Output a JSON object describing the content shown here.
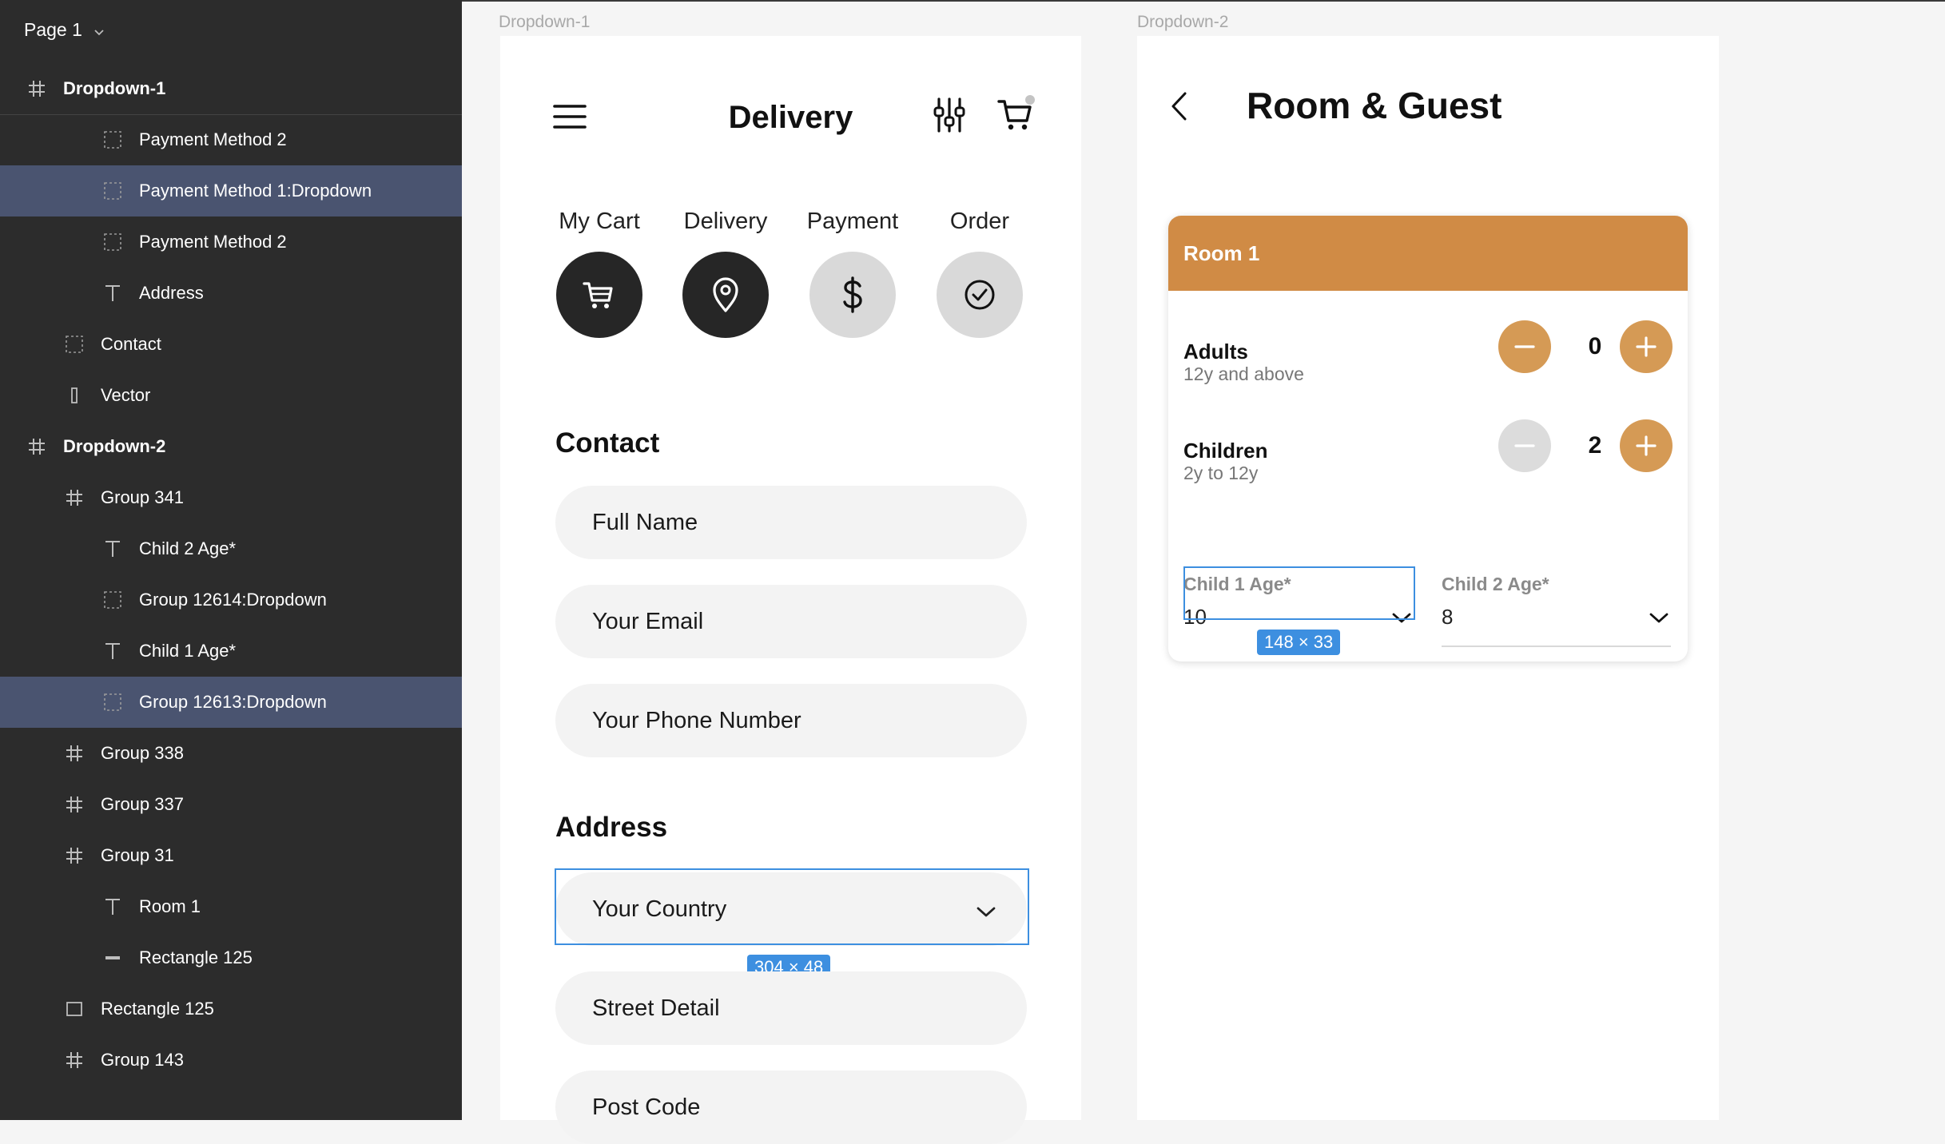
{
  "sidebar": {
    "page_title": "Page 1",
    "layers": [
      {
        "label": "Dropdown-1",
        "icon": "frame-icon",
        "depth": 1,
        "bold": true,
        "selected": false
      },
      {
        "label": "Payment Method 2",
        "icon": "component-instance-icon",
        "depth": 3,
        "bold": false,
        "selected": false
      },
      {
        "label": "Payment Method 1:Dropdown",
        "icon": "component-instance-icon",
        "depth": 3,
        "bold": false,
        "selected": true
      },
      {
        "label": "Payment Method 2",
        "icon": "component-instance-icon",
        "depth": 3,
        "bold": false,
        "selected": false
      },
      {
        "label": "Address",
        "icon": "text-icon",
        "depth": 3,
        "bold": false,
        "selected": false
      },
      {
        "label": "Contact",
        "icon": "component-instance-icon",
        "depth": 2,
        "bold": false,
        "selected": false
      },
      {
        "label": "Vector",
        "icon": "vector-icon",
        "depth": 2,
        "bold": false,
        "selected": false
      },
      {
        "label": "Dropdown-2",
        "icon": "frame-icon",
        "depth": 1,
        "bold": true,
        "selected": false
      },
      {
        "label": "Group 341",
        "icon": "frame-icon",
        "depth": 2,
        "bold": false,
        "selected": false
      },
      {
        "label": "Child 2 Age*",
        "icon": "text-icon",
        "depth": 3,
        "bold": false,
        "selected": false
      },
      {
        "label": "Group 12614:Dropdown",
        "icon": "component-instance-icon",
        "depth": 3,
        "bold": false,
        "selected": false
      },
      {
        "label": "Child 1 Age*",
        "icon": "text-icon",
        "depth": 3,
        "bold": false,
        "selected": false
      },
      {
        "label": "Group 12613:Dropdown",
        "icon": "component-instance-icon",
        "depth": 3,
        "bold": false,
        "selected": true
      },
      {
        "label": "Group 338",
        "icon": "frame-icon",
        "depth": 2,
        "bold": false,
        "selected": false
      },
      {
        "label": "Group 337",
        "icon": "frame-icon",
        "depth": 2,
        "bold": false,
        "selected": false
      },
      {
        "label": "Group 31",
        "icon": "frame-icon",
        "depth": 2,
        "bold": false,
        "selected": false
      },
      {
        "label": "Room 1",
        "icon": "text-icon",
        "depth": 3,
        "bold": false,
        "selected": false
      },
      {
        "label": "Rectangle 125",
        "icon": "line-icon",
        "depth": 3,
        "bold": false,
        "selected": false
      },
      {
        "label": "Rectangle 125",
        "icon": "rectangle-icon",
        "depth": 2,
        "bold": false,
        "selected": false
      },
      {
        "label": "Group 143",
        "icon": "frame-icon",
        "depth": 2,
        "bold": false,
        "selected": false
      }
    ]
  },
  "frame1": {
    "label": "Dropdown-1",
    "title": "Delivery",
    "steps": [
      {
        "label": "My Cart",
        "icon": "cart-icon",
        "state": "done"
      },
      {
        "label": "Delivery",
        "icon": "location-pin-icon",
        "state": "done"
      },
      {
        "label": "Payment",
        "icon": "dollar-icon",
        "state": "pending"
      },
      {
        "label": "Order",
        "icon": "check-circle-icon",
        "state": "pending"
      }
    ],
    "contact_title": "Contact",
    "contact_fields": [
      "Full Name",
      "Your Email",
      "Your Phone Number"
    ],
    "address_title": "Address",
    "country_placeholder": "Your Country",
    "address_fields": [
      "Street Detail",
      "Post Code"
    ],
    "selection_size": "304 × 48"
  },
  "frame2": {
    "label": "Dropdown-2",
    "title": "Room & Guest",
    "room_title": "Room 1",
    "adults": {
      "label": "Adults",
      "sub": "12y and above",
      "count": "0"
    },
    "children": {
      "label": "Children",
      "sub": "2y to 12y",
      "count": "2"
    },
    "child1": {
      "label": "Child 1 Age*",
      "value": "10"
    },
    "child2": {
      "label": "Child 2 Age*",
      "value": "8"
    },
    "selection_size": "148 × 33"
  },
  "colors": {
    "accent": "#d08b45",
    "selection": "#3d8fe0",
    "sidebar_bg": "#2c2c2c",
    "selected_row": "#4a5470"
  }
}
